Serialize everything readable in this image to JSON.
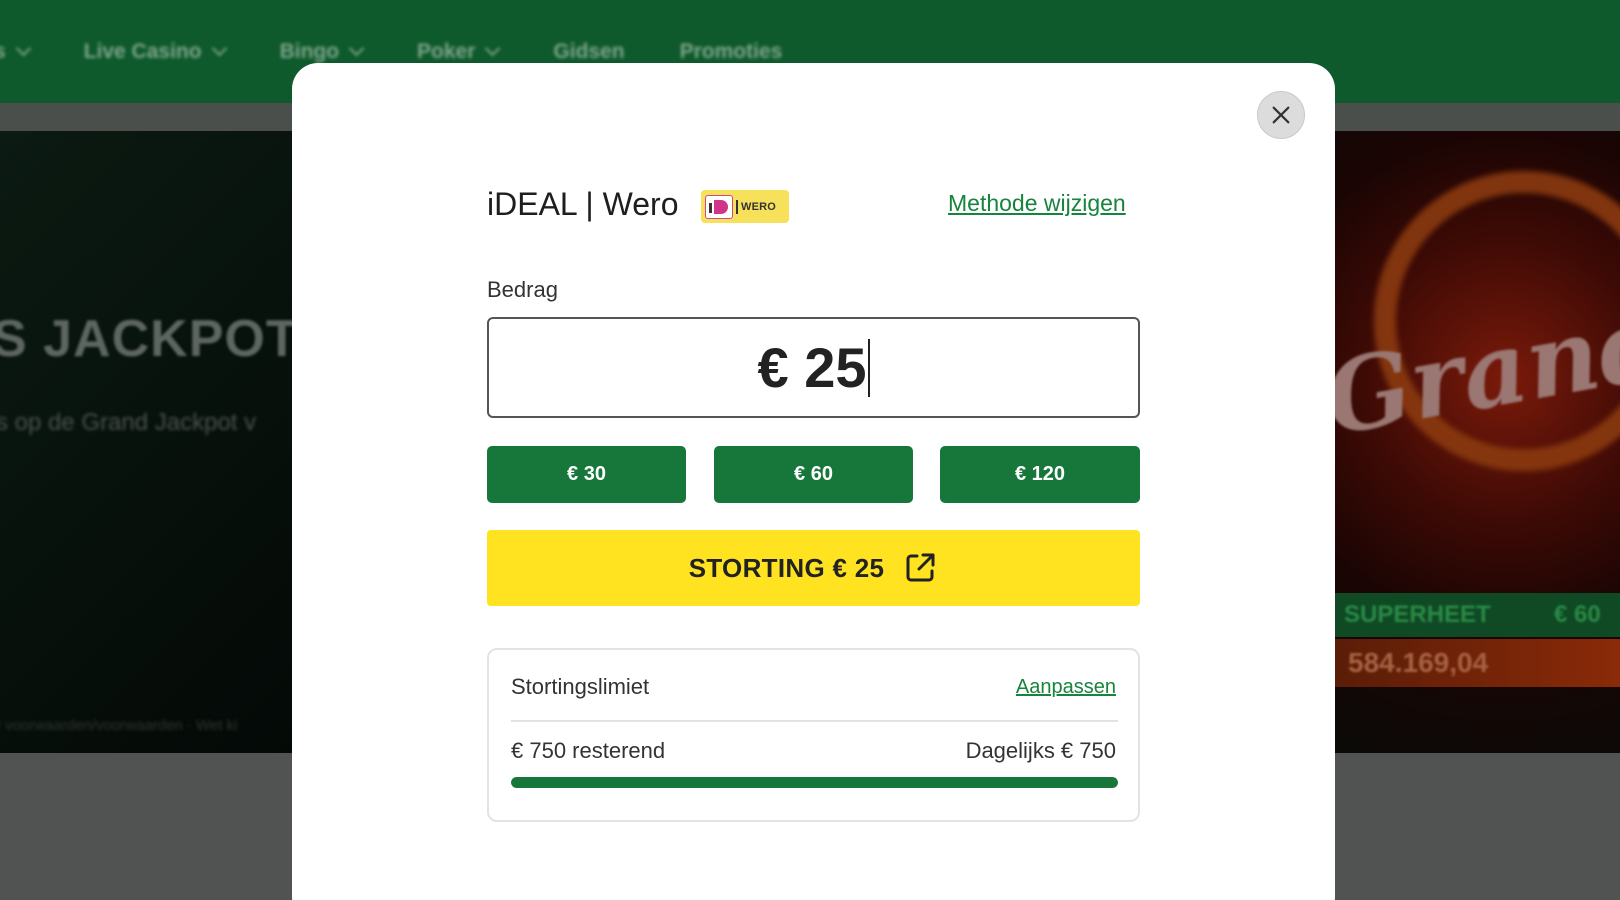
{
  "background": {
    "nav": [
      "s",
      "Live Casino",
      "Bingo",
      "Poker",
      "Gidsen",
      "Promoties"
    ],
    "hero_title": "S JACKPOT ST",
    "hero_sub": "s op de Grand Jackpot v",
    "hero_footer": "r voorwaarden/voorwaarden · Wet ki",
    "promo_word": "Grand",
    "jackpot_label": "SUPERHEET",
    "jackpot_label_right": "€ 60",
    "jackpot_value": "584.169,04"
  },
  "modal": {
    "close_icon": "close-icon",
    "method": {
      "title": "iDEAL | Wero",
      "logo_text": "WERO",
      "change_link": "Methode wijzigen"
    },
    "amount": {
      "label": "Bedrag",
      "value": "€ 25"
    },
    "quick_amounts": [
      "€ 30",
      "€ 60",
      "€ 120"
    ],
    "deposit_button": {
      "label": "STORTING € 25",
      "icon": "external-link-icon"
    },
    "limit": {
      "title": "Stortingslimiet",
      "edit_link": "Aanpassen",
      "remaining": "€ 750 resterend",
      "daily": "Dagelijks € 750",
      "progress_fraction": 1.0
    }
  },
  "colors": {
    "brand_green": "#17773a",
    "link_green": "#17843d",
    "deposit_yellow": "#ffe321"
  }
}
